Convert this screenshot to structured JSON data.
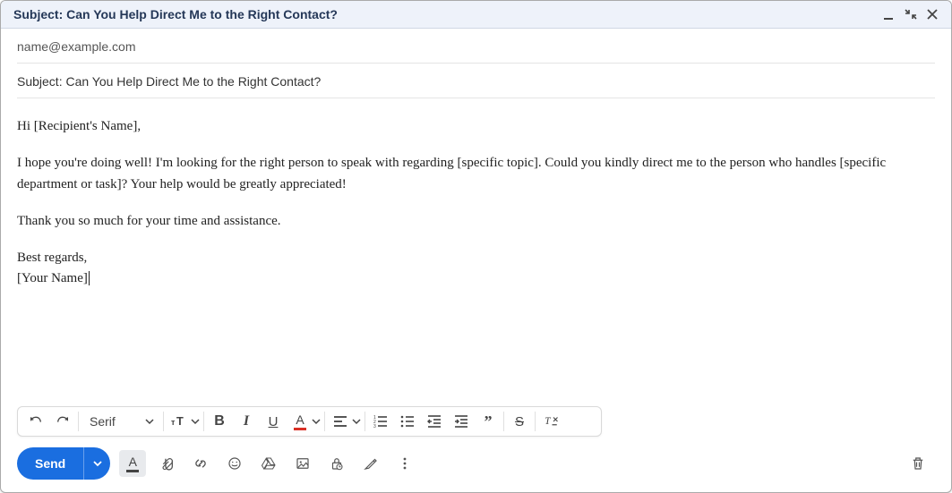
{
  "header": {
    "title": "Subject: Can You Help Direct Me to the Right Contact?"
  },
  "to": {
    "value": "name@example.com"
  },
  "subject": {
    "value": "Subject: Can You Help Direct Me to the Right Contact?"
  },
  "body": {
    "greeting": "Hi [Recipient's Name],",
    "p1": "I hope you're doing well! I'm looking for the right person to speak with regarding [specific topic]. Could you kindly direct me to the person who handles [specific department or task]? Your help would be greatly appreciated!",
    "p2": "Thank you so much for your time and assistance.",
    "signoff": "Best regards,",
    "name": "[Your Name]"
  },
  "format": {
    "font": "Serif"
  },
  "send": {
    "label": "Send"
  }
}
